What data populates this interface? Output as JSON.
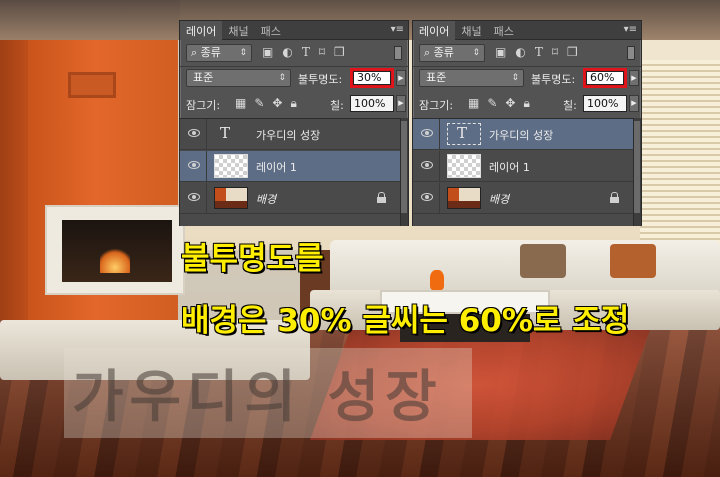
{
  "panels": [
    {
      "tabs": [
        "레이어",
        "채널",
        "패스"
      ],
      "menu_icon": "panel-menu-icon",
      "filter": {
        "kind_label": "종류"
      },
      "blend_mode": "표준",
      "opacity_label": "불투명도:",
      "opacity_value": "30%",
      "lock_label": "잠그기:",
      "fill_label": "칠:",
      "fill_value": "100%",
      "layers": [
        {
          "name": "가우디의 성장",
          "kind": "type",
          "selected": false
        },
        {
          "name": "레이어 1",
          "kind": "pixel",
          "selected": true
        },
        {
          "name": "배경",
          "kind": "background",
          "selected": false,
          "locked": true
        }
      ]
    },
    {
      "tabs": [
        "레이어",
        "채널",
        "패스"
      ],
      "menu_icon": "panel-menu-icon",
      "filter": {
        "kind_label": "종류"
      },
      "blend_mode": "표준",
      "opacity_label": "불투명도:",
      "opacity_value": "60%",
      "lock_label": "잠그기:",
      "fill_label": "칠:",
      "fill_value": "100%",
      "layers": [
        {
          "name": "가우디의 성장",
          "kind": "type",
          "selected": true
        },
        {
          "name": "레이어 1",
          "kind": "pixel",
          "selected": false
        },
        {
          "name": "배경",
          "kind": "background",
          "selected": false,
          "locked": true
        }
      ]
    }
  ],
  "captions": {
    "line1": "불투명도를",
    "line2": "배경은 30% 글씨는 60%로 조정"
  },
  "watermark": "가우디의 성장",
  "colors": {
    "caption_fill": "#ffee00",
    "caption_stroke": "#000000",
    "highlight_box": "#e0141b",
    "panel_bg": "#535353",
    "selected_layer": "#5d6d85"
  }
}
